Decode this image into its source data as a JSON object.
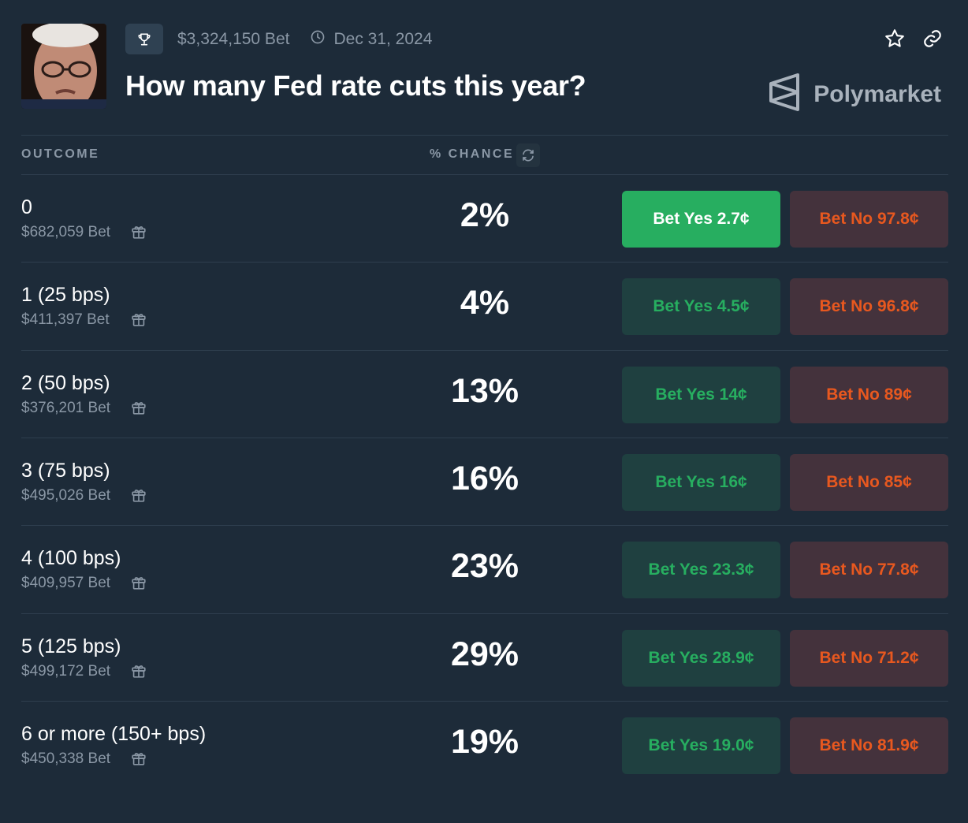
{
  "header": {
    "volume": "$3,324,150 Bet",
    "end_date": "Dec 31, 2024",
    "title": "How many Fed rate cuts this year?",
    "brand": "Polymarket"
  },
  "table": {
    "col_outcome": "OUTCOME",
    "col_chance": "% CHANCE"
  },
  "rows": [
    {
      "name": "0",
      "volume": "$682,059 Bet",
      "chance": "2%",
      "yes": "Bet Yes 2.7¢",
      "no": "Bet No 97.8¢"
    },
    {
      "name": "1 (25 bps)",
      "volume": "$411,397 Bet",
      "chance": "4%",
      "yes": "Bet Yes 4.5¢",
      "no": "Bet No 96.8¢"
    },
    {
      "name": "2 (50 bps)",
      "volume": "$376,201 Bet",
      "chance": "13%",
      "yes": "Bet Yes 14¢",
      "no": "Bet No 89¢"
    },
    {
      "name": "3 (75 bps)",
      "volume": "$495,026 Bet",
      "chance": "16%",
      "yes": "Bet Yes 16¢",
      "no": "Bet No 85¢"
    },
    {
      "name": "4 (100 bps)",
      "volume": "$409,957 Bet",
      "chance": "23%",
      "yes": "Bet Yes 23.3¢",
      "no": "Bet No 77.8¢"
    },
    {
      "name": "5 (125 bps)",
      "volume": "$499,172 Bet",
      "chance": "29%",
      "yes": "Bet Yes 28.9¢",
      "no": "Bet No 71.2¢"
    },
    {
      "name": "6 or more (150+ bps)",
      "volume": "$450,338 Bet",
      "chance": "19%",
      "yes": "Bet Yes 19.0¢",
      "no": "Bet No 81.9¢"
    }
  ],
  "colors": {
    "background": "#1d2b39",
    "yes_green": "#27ae60",
    "no_orange": "#e8581f"
  },
  "icons": [
    "trophy-icon",
    "clock-icon",
    "star-icon",
    "link-icon",
    "polymarket-logo-icon",
    "refresh-icon",
    "gift-icon"
  ]
}
